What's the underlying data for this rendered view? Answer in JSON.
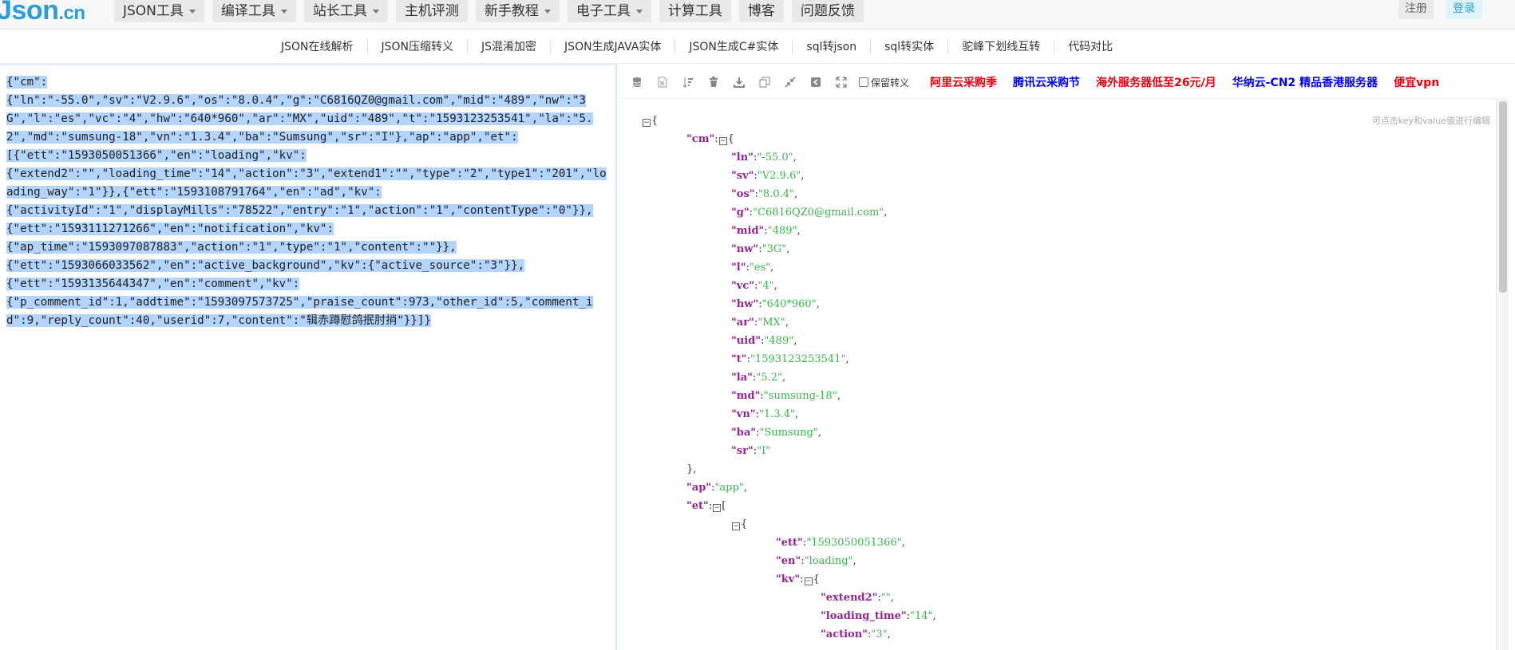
{
  "brand": {
    "logo_main": "Json",
    "logo_suffix": ".cn"
  },
  "menu": [
    {
      "label": "JSON工具",
      "dropdown": true
    },
    {
      "label": "编译工具",
      "dropdown": true
    },
    {
      "label": "站长工具",
      "dropdown": true
    },
    {
      "label": "主机评测",
      "dropdown": false
    },
    {
      "label": "新手教程",
      "dropdown": true
    },
    {
      "label": "电子工具",
      "dropdown": true
    },
    {
      "label": "计算工具",
      "dropdown": false
    },
    {
      "label": "博客",
      "dropdown": false
    },
    {
      "label": "问题反馈",
      "dropdown": false
    }
  ],
  "auth": {
    "register": "注册",
    "login": "登录"
  },
  "subnav": [
    "JSON在线解析",
    "JSON压缩转义",
    "JS混淆加密",
    "JSON生成JAVA实体",
    "JSON生成C#实体",
    "sql转json",
    "sql转实体",
    "驼峰下划线互转",
    "代码对比"
  ],
  "editor": {
    "text": "{\"cm\":\n{\"ln\":\"-55.0\",\"sv\":\"V2.9.6\",\"os\":\"8.0.4\",\"g\":\"C6816QZ0@gmail.com\",\"mid\":\"489\",\"nw\":\"3G\",\"l\":\"es\",\"vc\":\"4\",\"hw\":\"640*960\",\"ar\":\"MX\",\"uid\":\"489\",\"t\":\"1593123253541\",\"la\":\"5.2\",\"md\":\"sumsung-18\",\"vn\":\"1.3.4\",\"ba\":\"Sumsung\",\"sr\":\"I\"},\"ap\":\"app\",\"et\":\n[{\"ett\":\"1593050051366\",\"en\":\"loading\",\"kv\":\n{\"extend2\":\"\",\"loading_time\":\"14\",\"action\":\"3\",\"extend1\":\"\",\"type\":\"2\",\"type1\":\"201\",\"loading_way\":\"1\"}},{\"ett\":\"1593108791764\",\"en\":\"ad\",\"kv\":\n{\"activityId\":\"1\",\"displayMills\":\"78522\",\"entry\":\"1\",\"action\":\"1\",\"contentType\":\"0\"}},\n{\"ett\":\"1593111271266\",\"en\":\"notification\",\"kv\":\n{\"ap_time\":\"1593097087883\",\"action\":\"1\",\"type\":\"1\",\"content\":\"\"}},\n{\"ett\":\"1593066033562\",\"en\":\"active_background\",\"kv\":{\"active_source\":\"3\"}},\n{\"ett\":\"1593135644347\",\"en\":\"comment\",\"kv\":\n{\"p_comment_id\":1,\"addtime\":\"1593097573725\",\"praise_count\":973,\"other_id\":5,\"comment_id\":9,\"reply_count\":40,\"userid\":7,\"content\":\"辑赤蹲慰鸽抿肘捎\"}}]}"
  },
  "toolbar": {
    "icons": [
      "database-icon",
      "excel-icon",
      "sort-icon",
      "trash-icon",
      "download-icon",
      "copy-icon",
      "compress-icon",
      "escape-icon",
      "expand-icon"
    ],
    "checkbox_label": "保留转义",
    "ads": [
      {
        "label": "阿里云采购季",
        "color": "#e60012"
      },
      {
        "label": "腾讯云采购节",
        "color": "#0000ee"
      },
      {
        "label": "海外服务器低至26元/月",
        "color": "#e60012"
      },
      {
        "label": "华纳云-CN2 精品香港服务器",
        "color": "#0000ee"
      },
      {
        "label": "便宜vpn",
        "color": "#e60012"
      }
    ]
  },
  "viewer": {
    "hint": "可点击key和value值进行编辑",
    "rows": [
      {
        "indent": 0,
        "tokens": [
          {
            "c": "coll",
            "t": "−"
          },
          {
            "c": "p",
            "t": "{"
          }
        ]
      },
      {
        "indent": 1,
        "tokens": [
          {
            "c": "k",
            "t": "\"cm\""
          },
          {
            "c": "p",
            "t": ":"
          },
          {
            "c": "coll",
            "t": "−"
          },
          {
            "c": "p",
            "t": "{"
          }
        ]
      },
      {
        "indent": 2,
        "tokens": [
          {
            "c": "k",
            "t": "\"ln\""
          },
          {
            "c": "p",
            "t": ":"
          },
          {
            "c": "s",
            "t": "\"-55.0\""
          },
          {
            "c": "p",
            "t": ","
          }
        ]
      },
      {
        "indent": 2,
        "tokens": [
          {
            "c": "k",
            "t": "\"sv\""
          },
          {
            "c": "p",
            "t": ":"
          },
          {
            "c": "s",
            "t": "\"V2.9.6\""
          },
          {
            "c": "p",
            "t": ","
          }
        ]
      },
      {
        "indent": 2,
        "tokens": [
          {
            "c": "k",
            "t": "\"os\""
          },
          {
            "c": "p",
            "t": ":"
          },
          {
            "c": "s",
            "t": "\"8.0.4\""
          },
          {
            "c": "p",
            "t": ","
          }
        ]
      },
      {
        "indent": 2,
        "tokens": [
          {
            "c": "k",
            "t": "\"g\""
          },
          {
            "c": "p",
            "t": ":"
          },
          {
            "c": "s",
            "t": "\"C6816QZ0@gmail.com\""
          },
          {
            "c": "p",
            "t": ","
          }
        ]
      },
      {
        "indent": 2,
        "tokens": [
          {
            "c": "k",
            "t": "\"mid\""
          },
          {
            "c": "p",
            "t": ":"
          },
          {
            "c": "s",
            "t": "\"489\""
          },
          {
            "c": "p",
            "t": ","
          }
        ]
      },
      {
        "indent": 2,
        "tokens": [
          {
            "c": "k",
            "t": "\"nw\""
          },
          {
            "c": "p",
            "t": ":"
          },
          {
            "c": "s",
            "t": "\"3G\""
          },
          {
            "c": "p",
            "t": ","
          }
        ]
      },
      {
        "indent": 2,
        "tokens": [
          {
            "c": "k",
            "t": "\"l\""
          },
          {
            "c": "p",
            "t": ":"
          },
          {
            "c": "s",
            "t": "\"es\""
          },
          {
            "c": "p",
            "t": ","
          }
        ]
      },
      {
        "indent": 2,
        "tokens": [
          {
            "c": "k",
            "t": "\"vc\""
          },
          {
            "c": "p",
            "t": ":"
          },
          {
            "c": "s",
            "t": "\"4\""
          },
          {
            "c": "p",
            "t": ","
          }
        ]
      },
      {
        "indent": 2,
        "tokens": [
          {
            "c": "k",
            "t": "\"hw\""
          },
          {
            "c": "p",
            "t": ":"
          },
          {
            "c": "s",
            "t": "\"640*960\""
          },
          {
            "c": "p",
            "t": ","
          }
        ]
      },
      {
        "indent": 2,
        "tokens": [
          {
            "c": "k",
            "t": "\"ar\""
          },
          {
            "c": "p",
            "t": ":"
          },
          {
            "c": "s",
            "t": "\"MX\""
          },
          {
            "c": "p",
            "t": ","
          }
        ]
      },
      {
        "indent": 2,
        "tokens": [
          {
            "c": "k",
            "t": "\"uid\""
          },
          {
            "c": "p",
            "t": ":"
          },
          {
            "c": "s",
            "t": "\"489\""
          },
          {
            "c": "p",
            "t": ","
          }
        ]
      },
      {
        "indent": 2,
        "tokens": [
          {
            "c": "k",
            "t": "\"t\""
          },
          {
            "c": "p",
            "t": ":"
          },
          {
            "c": "s",
            "t": "\"1593123253541\""
          },
          {
            "c": "p",
            "t": ","
          }
        ]
      },
      {
        "indent": 2,
        "tokens": [
          {
            "c": "k",
            "t": "\"la\""
          },
          {
            "c": "p",
            "t": ":"
          },
          {
            "c": "s",
            "t": "\"5.2\""
          },
          {
            "c": "p",
            "t": ","
          }
        ]
      },
      {
        "indent": 2,
        "tokens": [
          {
            "c": "k",
            "t": "\"md\""
          },
          {
            "c": "p",
            "t": ":"
          },
          {
            "c": "s",
            "t": "\"sumsung-18\""
          },
          {
            "c": "p",
            "t": ","
          }
        ]
      },
      {
        "indent": 2,
        "tokens": [
          {
            "c": "k",
            "t": "\"vn\""
          },
          {
            "c": "p",
            "t": ":"
          },
          {
            "c": "s",
            "t": "\"1.3.4\""
          },
          {
            "c": "p",
            "t": ","
          }
        ]
      },
      {
        "indent": 2,
        "tokens": [
          {
            "c": "k",
            "t": "\"ba\""
          },
          {
            "c": "p",
            "t": ":"
          },
          {
            "c": "s",
            "t": "\"Sumsung\""
          },
          {
            "c": "p",
            "t": ","
          }
        ]
      },
      {
        "indent": 2,
        "tokens": [
          {
            "c": "k",
            "t": "\"sr\""
          },
          {
            "c": "p",
            "t": ":"
          },
          {
            "c": "s",
            "t": "\"I\""
          }
        ]
      },
      {
        "indent": 1,
        "tokens": [
          {
            "c": "p",
            "t": "},"
          }
        ]
      },
      {
        "indent": 1,
        "tokens": [
          {
            "c": "k",
            "t": "\"ap\""
          },
          {
            "c": "p",
            "t": ":"
          },
          {
            "c": "s",
            "t": "\"app\""
          },
          {
            "c": "p",
            "t": ","
          }
        ]
      },
      {
        "indent": 1,
        "tokens": [
          {
            "c": "k",
            "t": "\"et\""
          },
          {
            "c": "p",
            "t": ":"
          },
          {
            "c": "coll",
            "t": "−"
          },
          {
            "c": "p",
            "t": "["
          }
        ]
      },
      {
        "indent": 2,
        "tokens": [
          {
            "c": "coll",
            "t": "−"
          },
          {
            "c": "p",
            "t": "{"
          }
        ]
      },
      {
        "indent": 3,
        "tokens": [
          {
            "c": "k",
            "t": "\"ett\""
          },
          {
            "c": "p",
            "t": ":"
          },
          {
            "c": "s",
            "t": "\"1593050051366\""
          },
          {
            "c": "p",
            "t": ","
          }
        ]
      },
      {
        "indent": 3,
        "tokens": [
          {
            "c": "k",
            "t": "\"en\""
          },
          {
            "c": "p",
            "t": ":"
          },
          {
            "c": "s",
            "t": "\"loading\""
          },
          {
            "c": "p",
            "t": ","
          }
        ]
      },
      {
        "indent": 3,
        "tokens": [
          {
            "c": "k",
            "t": "\"kv\""
          },
          {
            "c": "p",
            "t": ":"
          },
          {
            "c": "coll",
            "t": "−"
          },
          {
            "c": "p",
            "t": "{"
          }
        ]
      },
      {
        "indent": 4,
        "tokens": [
          {
            "c": "k",
            "t": "\"extend2\""
          },
          {
            "c": "p",
            "t": ":"
          },
          {
            "c": "s",
            "t": "\"\""
          },
          {
            "c": "p",
            "t": ","
          }
        ]
      },
      {
        "indent": 4,
        "tokens": [
          {
            "c": "k",
            "t": "\"loading_time\""
          },
          {
            "c": "p",
            "t": ":"
          },
          {
            "c": "s",
            "t": "\"14\""
          },
          {
            "c": "p",
            "t": ","
          }
        ]
      },
      {
        "indent": 4,
        "tokens": [
          {
            "c": "k",
            "t": "\"action\""
          },
          {
            "c": "p",
            "t": ":"
          },
          {
            "c": "s",
            "t": "\"3\""
          },
          {
            "c": "p",
            "t": ","
          }
        ]
      }
    ]
  }
}
